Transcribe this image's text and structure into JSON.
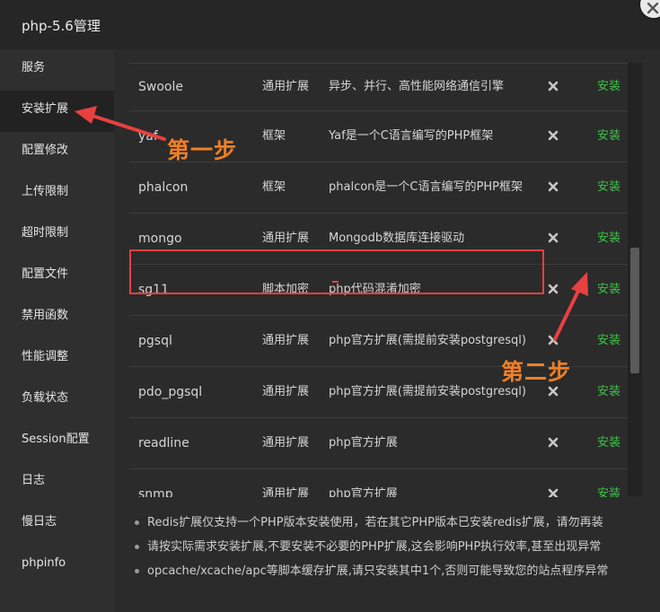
{
  "window": {
    "title": "php-5.6管理",
    "close_icon": "close-icon"
  },
  "sidebar": {
    "items": [
      {
        "label": "服务"
      },
      {
        "label": "安装扩展",
        "active": true
      },
      {
        "label": "配置修改"
      },
      {
        "label": "上传限制"
      },
      {
        "label": "超时限制"
      },
      {
        "label": "配置文件"
      },
      {
        "label": "禁用函数"
      },
      {
        "label": "性能调整"
      },
      {
        "label": "负载状态"
      },
      {
        "label": "Session配置"
      },
      {
        "label": "日志"
      },
      {
        "label": "慢日志"
      },
      {
        "label": "phpinfo"
      }
    ]
  },
  "extensions": {
    "rows": [
      {
        "name": "Swoole",
        "type": "通用扩展",
        "desc": "异步、并行、高性能网络通信引擎",
        "action": "安装"
      },
      {
        "name": "yaf",
        "type": "框架",
        "desc": "Yaf是一个C语言编写的PHP框架",
        "action": "安装"
      },
      {
        "name": "phalcon",
        "type": "框架",
        "desc": "phalcon是一个C语言编写的PHP框架",
        "action": "安装"
      },
      {
        "name": "mongo",
        "type": "通用扩展",
        "desc": "Mongodb数据库连接驱动",
        "action": "安装"
      },
      {
        "name": "sg11",
        "type": "脚本加密",
        "desc": "php代码混淆加密",
        "action": "安装"
      },
      {
        "name": "pgsql",
        "type": "通用扩展",
        "desc": "php官方扩展(需提前安装postgresql)",
        "action": "安装"
      },
      {
        "name": "pdo_pgsql",
        "type": "通用扩展",
        "desc": "php官方扩展(需提前安装postgresql)",
        "action": "安装"
      },
      {
        "name": "readline",
        "type": "通用扩展",
        "desc": "php官方扩展",
        "action": "安装"
      },
      {
        "name": "snmp",
        "type": "通用扩展",
        "desc": "php官方扩展",
        "action": "安装"
      }
    ]
  },
  "tips": [
    "Redis扩展仅支持一个PHP版本安装使用，若在其它PHP版本已安装redis扩展，请勿再装",
    "请按实际需求安装扩展,不要安装不必要的PHP扩展,这会影响PHP执行效率,甚至出现异常",
    "opcache/xcache/apc等脚本缓存扩展,请只安装其中1个,否则可能导致您的站点程序异常"
  ],
  "annotations": {
    "step1": "第一步",
    "step2": "第二步"
  },
  "colors": {
    "install": "#3fc24a",
    "annotation": "#f07f24",
    "highlight": "#e84040",
    "arrow": "#e84040"
  }
}
